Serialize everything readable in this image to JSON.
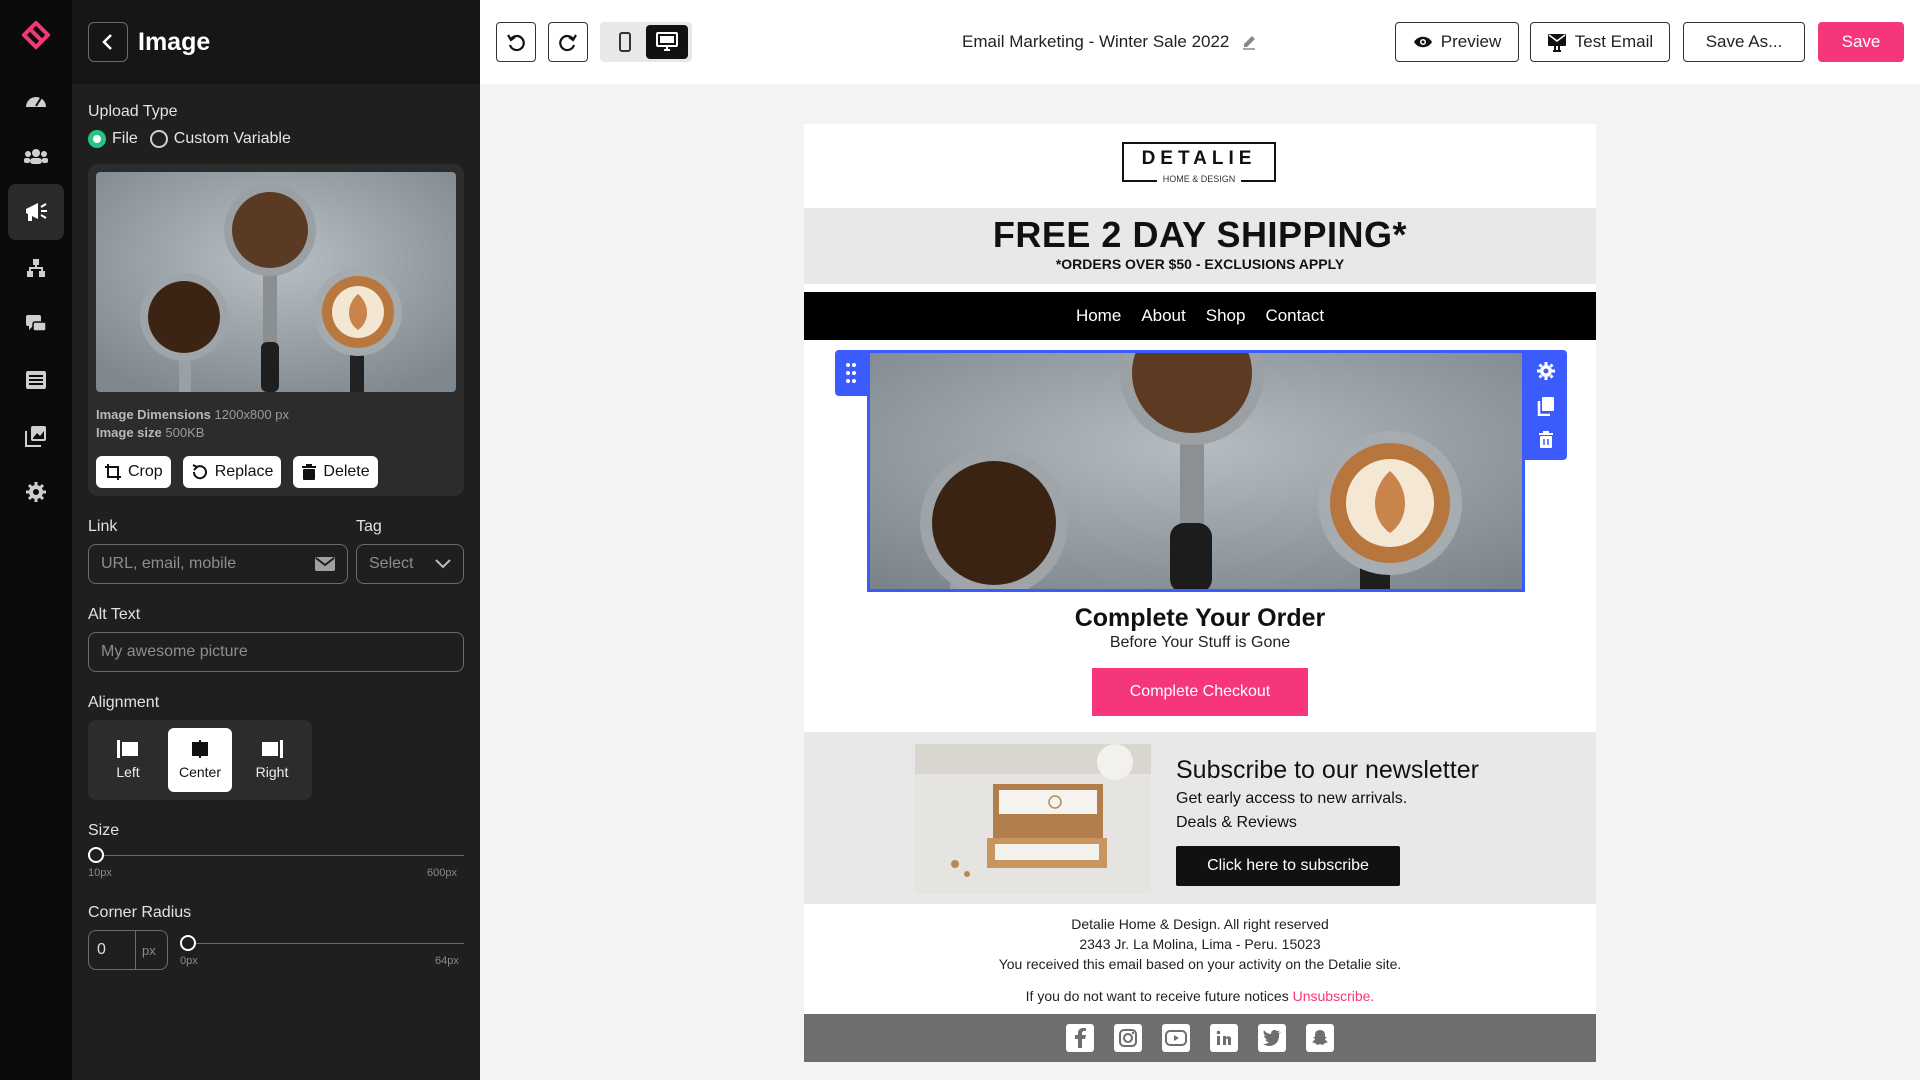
{
  "panel": {
    "title": "Image",
    "upload_type_label": "Upload Type",
    "upload_options": [
      "File",
      "Custom Variable"
    ],
    "upload_selected": "File",
    "image_dimensions_label": "Image Dimensions",
    "image_dimensions_value": "1200x800 px",
    "image_size_label": "Image size",
    "image_size_value": "500KB",
    "crop_label": "Crop",
    "replace_label": "Replace",
    "delete_label": "Delete",
    "link_label": "Link",
    "link_placeholder": "URL, email, mobile",
    "tag_label": "Tag",
    "tag_placeholder": "Select",
    "alt_label": "Alt Text",
    "alt_placeholder": "My awesome picture",
    "alignment_label": "Alignment",
    "alignment_options": [
      "Left",
      "Center",
      "Right"
    ],
    "alignment_selected": "Center",
    "size_label": "Size",
    "size_min": "10px",
    "size_max": "600px",
    "size_value_fraction": 0,
    "radius_label": "Corner Radius",
    "radius_value": "0",
    "radius_unit": "px",
    "radius_min": "0px",
    "radius_max": "64px",
    "radius_value_fraction": 0
  },
  "topbar": {
    "doc_title": "Email Marketing - Winter Sale 2022",
    "preview_label": "Preview",
    "test_email_label": "Test Email",
    "save_as_label": "Save As...",
    "save_label": "Save",
    "active_device": "desktop"
  },
  "email": {
    "logo_main": "DETALIE",
    "logo_sub": "HOME & DESIGN",
    "ship_title": "FREE 2 DAY SHIPPING*",
    "ship_sub": "*ORDERS OVER $50 - EXCLUSIONS APPLY",
    "nav": [
      "Home",
      "About",
      "Shop",
      "Contact"
    ],
    "order_title": "Complete Your Order",
    "order_sub": "Before Your Stuff is Gone",
    "checkout_label": "Complete Checkout",
    "news_title": "Subscribe to our newsletter",
    "news_line1": "Get early access to new arrivals.",
    "news_line2": "Deals & Reviews",
    "news_btn": "Click here to subscribe",
    "footer_1": "Detalie Home & Design. All right reserved",
    "footer_2": "2343 Jr. La Molina, Lima - Peru. 15023",
    "footer_3": "You received this email based on your activity on the Detalie site.",
    "footer_4": "If you do not want to receive future notices",
    "unsubscribe": "Unsubscribe.",
    "social": [
      "facebook-icon",
      "instagram-icon",
      "youtube-icon",
      "linkedin-icon",
      "twitter-icon",
      "snapchat-icon"
    ]
  },
  "colors": {
    "accent": "#f5367a",
    "selection": "#3b5bfd",
    "radio_on": "#27c486",
    "rail_bg": "#0b0b0b",
    "panel_bg": "#1f1f1f"
  }
}
